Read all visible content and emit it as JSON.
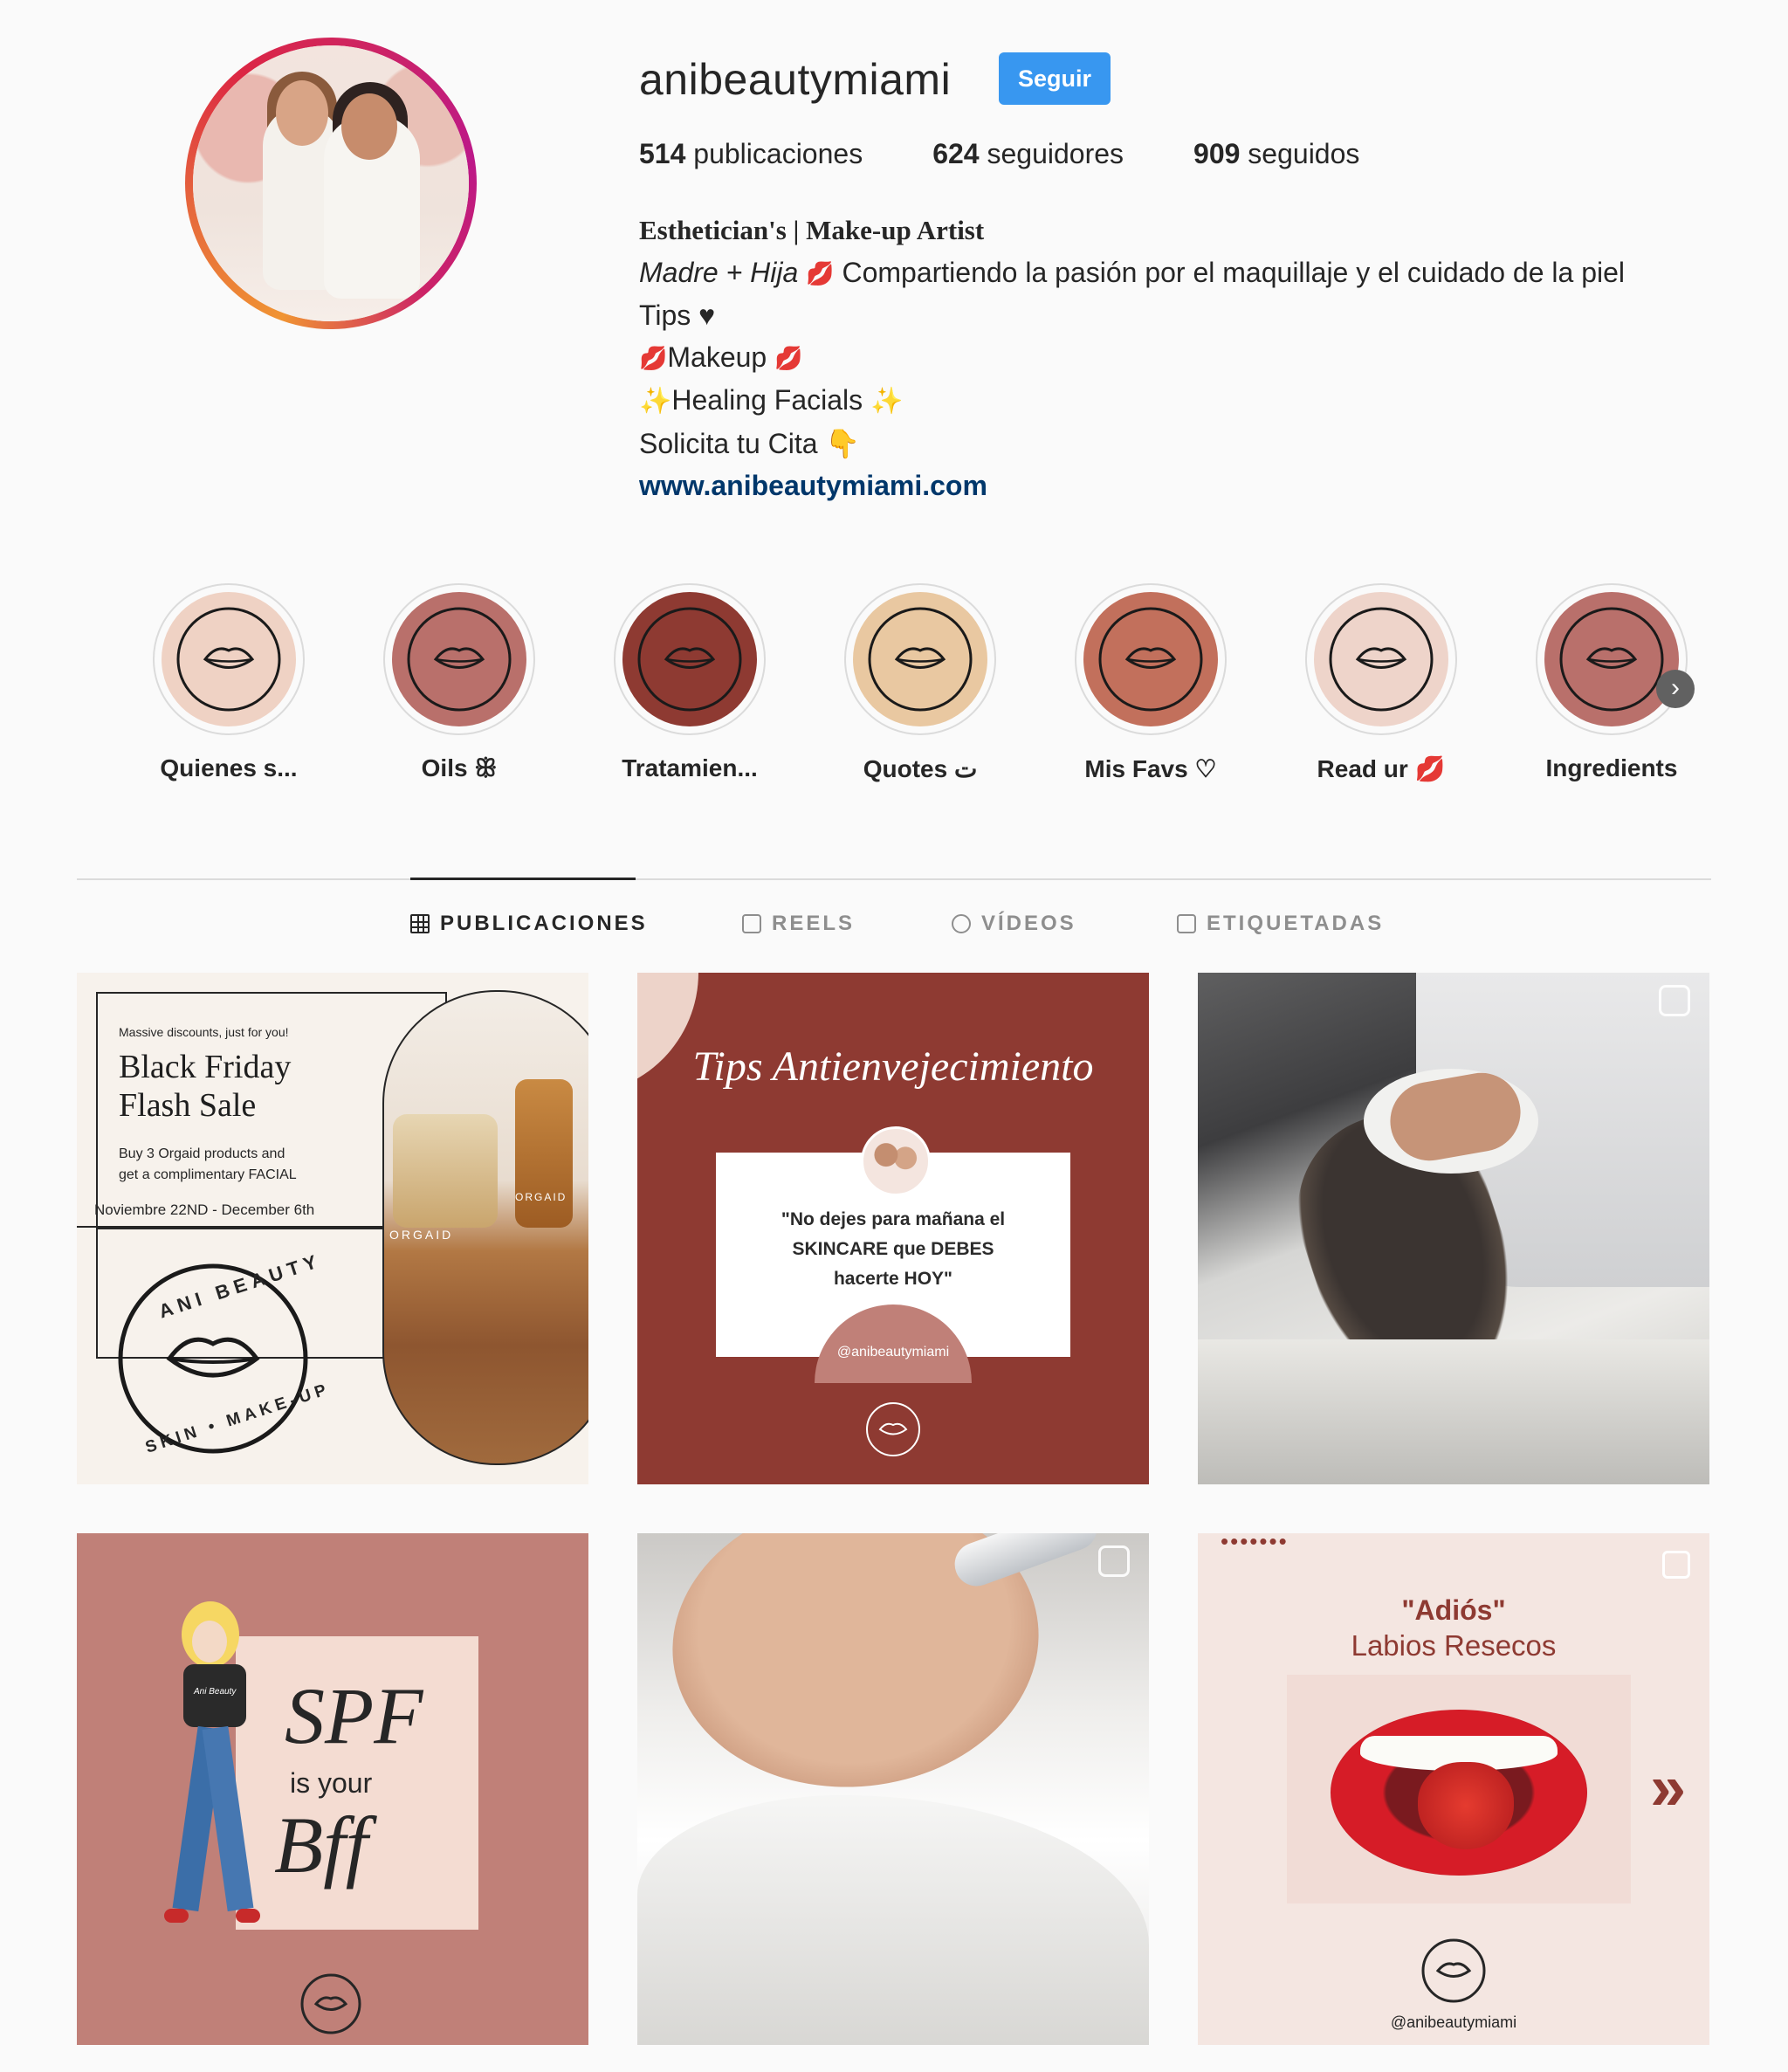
{
  "profile": {
    "username": "anibeautymiami",
    "follow_label": "Seguir",
    "stats": [
      {
        "count": "514",
        "label": "publicaciones"
      },
      {
        "count": "624",
        "label": "seguidores"
      },
      {
        "count": "909",
        "label": "seguidos"
      }
    ],
    "bio": {
      "name": "Esthetician's | Make-up Artist",
      "line1_italic": "Madre + Hija",
      "line1_rest": "Compartiendo la pasión por el maquillaje y el cuidado de la piel",
      "line2": "Tips ♥",
      "line3": "Makeup",
      "line4": "Healing Facials",
      "line5": "Solicita tu Cita",
      "link": "www.anibeautymiami.com"
    }
  },
  "highlights": [
    {
      "label": "Quienes s...",
      "color": "#efd2c4"
    },
    {
      "label": "Oils ꕥ",
      "color": "#b9706b"
    },
    {
      "label": "Tratamien...",
      "color": "#8e3a32"
    },
    {
      "label": "Quotes ت",
      "color": "#e9c8a1"
    },
    {
      "label": "Mis Favs ♡",
      "color": "#c2705c"
    },
    {
      "label": "Read ur 💋",
      "color": "#eed4ca"
    },
    {
      "label": "Ingredients",
      "color": "#b9706b"
    }
  ],
  "highlight_logo": {
    "top": "ANI BEAUTY",
    "bottom": "SKIN • MAKE-UP"
  },
  "tabs": [
    {
      "label": "PUBLICACIONES",
      "icon": "grid-icon",
      "active": true
    },
    {
      "label": "REELS",
      "icon": "reels-icon",
      "active": false
    },
    {
      "label": "VÍDEOS",
      "icon": "video-icon",
      "active": false
    },
    {
      "label": "ETIQUETADAS",
      "icon": "tagged-icon",
      "active": false
    }
  ],
  "posts": {
    "p1": {
      "small": "Massive discounts, just for you!",
      "title1": "Black Friday",
      "title2": "Flash Sale",
      "body1": "Buy 3 Orgaid products and",
      "body2": "get a complimentary FACIAL",
      "dates": "Noviembre 22ND - December 6th",
      "logo_top": "ANI BEAUTY",
      "logo_bottom": "SKIN • MAKE-UP",
      "jar_text": "ORGAID",
      "bottle_text": "ORGAID"
    },
    "p2": {
      "script_title": "Tips Antienvejecimiento",
      "quote1": "\"No dejes para mañana el",
      "quote2": "SKINCARE que DEBES",
      "quote3": "hacerte HOY\"",
      "handle": "@anibeautymiami"
    },
    "p4": {
      "spf": "SPF",
      "is_your": "is your",
      "bff": "Bff",
      "shirt": "Ani Beauty"
    },
    "p6": {
      "dots": "•••••••",
      "adios": "\"Adiós\"",
      "subtitle": "Labios Resecos",
      "arrow": "»",
      "handle": "@anibeautymiami"
    }
  },
  "colors": {
    "follow": "#3897f0",
    "link": "#00376b",
    "brand_red": "#8e3a32",
    "brand_rose": "#c08078"
  }
}
